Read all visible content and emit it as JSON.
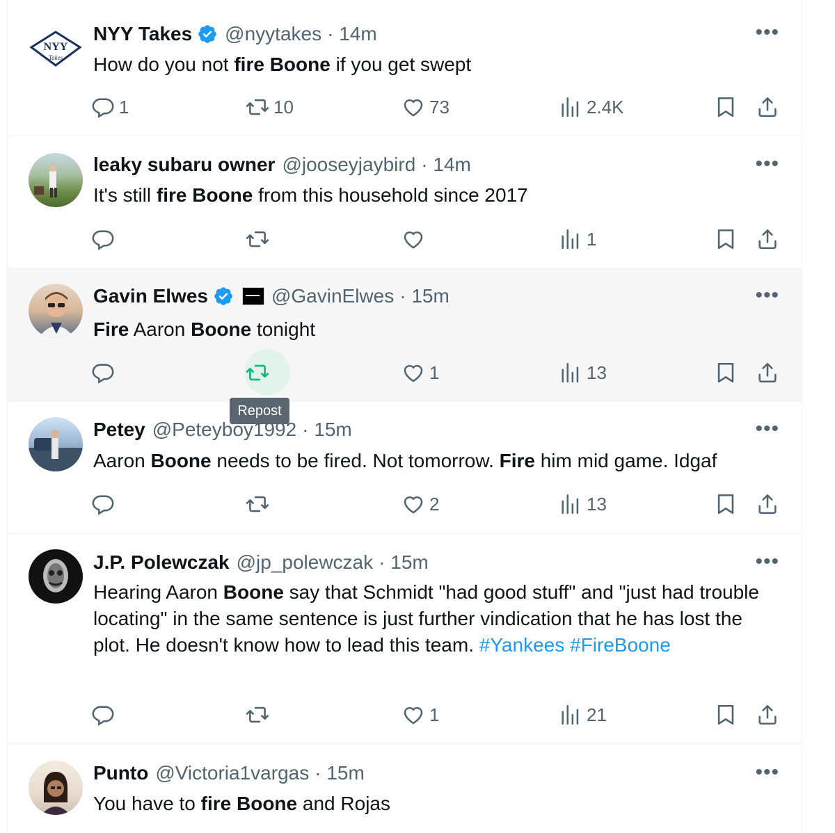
{
  "tweets": [
    {
      "name": "NYY Takes",
      "handle": "@nyytakes",
      "time": "· 14m",
      "verified": true,
      "segments": [
        {
          "t": "How do you not ",
          "b": false
        },
        {
          "t": "fire Boone",
          "b": true
        },
        {
          "t": " if you get swept",
          "b": false
        }
      ],
      "counts": {
        "reply": "1",
        "repost": "10",
        "like": "73",
        "views": "2.4K"
      }
    },
    {
      "name": "leaky subaru owner",
      "handle": "@jooseyjaybird",
      "time": "· 14m",
      "verified": false,
      "segments": [
        {
          "t": "It's still ",
          "b": false
        },
        {
          "t": "fire Boone",
          "b": true
        },
        {
          "t": " from this household since 2017",
          "b": false
        }
      ],
      "counts": {
        "reply": "",
        "repost": "",
        "like": "",
        "views": "1"
      }
    },
    {
      "name": "Gavin Elwes",
      "handle": "@GavinElwes",
      "time": "· 15m",
      "verified": true,
      "segments": [
        {
          "t": "Fire",
          "b": true
        },
        {
          "t": " Aaron ",
          "b": false
        },
        {
          "t": "Boone",
          "b": true
        },
        {
          "t": " tonight",
          "b": false
        }
      ],
      "counts": {
        "reply": "",
        "repost": "",
        "like": "1",
        "views": "13"
      }
    },
    {
      "name": "Petey",
      "handle": "@Peteyboy1992",
      "time": "· 15m",
      "verified": false,
      "segments": [
        {
          "t": "Aaron ",
          "b": false
        },
        {
          "t": "Boone",
          "b": true
        },
        {
          "t": " needs to be fired. Not tomorrow. ",
          "b": false
        },
        {
          "t": "Fire",
          "b": true
        },
        {
          "t": " him mid game. Idgaf",
          "b": false
        }
      ],
      "counts": {
        "reply": "",
        "repost": "",
        "like": "2",
        "views": "13"
      }
    },
    {
      "name": "J.P. Polewczak",
      "handle": "@jp_polewczak",
      "time": "· 15m",
      "verified": false,
      "segments": [
        {
          "t": "Hearing Aaron ",
          "b": false
        },
        {
          "t": "Boone",
          "b": true
        },
        {
          "t": " say that Schmidt \"had good stuff\" and \"just had trouble locating\" in the same sentence is just further vindication that he has lost the plot. He doesn't know how to lead this team. ",
          "b": false
        },
        {
          "t": "#Yankees",
          "b": false,
          "h": true
        },
        {
          "t": " ",
          "b": false
        },
        {
          "t": "#FireBoone",
          "b": false,
          "h": true
        }
      ],
      "counts": {
        "reply": "",
        "repost": "",
        "like": "1",
        "views": "21"
      }
    },
    {
      "name": "Punto",
      "handle": "@Victoria1vargas",
      "time": "· 15m",
      "verified": false,
      "segments": [
        {
          "t": "You have to ",
          "b": false
        },
        {
          "t": "fire Boone",
          "b": true
        },
        {
          "t": " and Rojas",
          "b": false
        }
      ],
      "counts": null
    }
  ],
  "tooltip": {
    "label": "Repost"
  },
  "avatars": {
    "nyy_logo_text": "NYY",
    "nyy_logo_sub": "Takes"
  },
  "colors": {
    "accent": "#1d9bf0",
    "repost_green": "#00ba7c",
    "muted": "#536471"
  }
}
